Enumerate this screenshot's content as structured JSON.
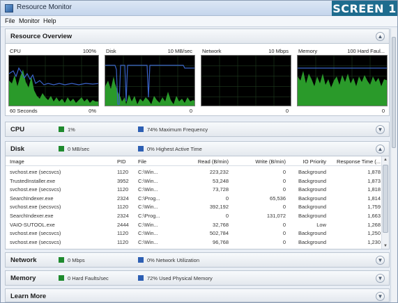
{
  "window": {
    "title": "Resource Monitor",
    "badge": "SCREEN 1"
  },
  "menu": [
    "File",
    "Monitor",
    "Help"
  ],
  "overview": {
    "title": "Resource Overview",
    "graphs": [
      {
        "name": "CPU",
        "max": "100%",
        "foot_left": "60 Seconds",
        "foot_right": "0%"
      },
      {
        "name": "Disk",
        "max": "10 MB/sec",
        "foot_left": "",
        "foot_right": "0"
      },
      {
        "name": "Network",
        "max": "10 Mbps",
        "foot_left": "",
        "foot_right": "0"
      },
      {
        "name": "Memory",
        "max": "100 Hard Faul...",
        "foot_left": "",
        "foot_right": "0"
      }
    ]
  },
  "cpu": {
    "title": "CPU",
    "stat1": "1%",
    "stat2": "74% Maximum Frequency"
  },
  "disk": {
    "title": "Disk",
    "stat1": "0 MB/sec",
    "stat2": "0% Highest Active Time",
    "columns": [
      "Image",
      "PID",
      "File",
      "Read (B/min)",
      "Write (B/min)",
      "IO Priority",
      "Response Time (..."
    ],
    "rows": [
      [
        "svchost.exe (secsvcs)",
        "1120",
        "C:\\Win...",
        "223,232",
        "0",
        "Background",
        "1,878"
      ],
      [
        "TrustedInstaller.exe",
        "3952",
        "C:\\Win...",
        "53,248",
        "0",
        "Background",
        "1,873"
      ],
      [
        "svchost.exe (secsvcs)",
        "1120",
        "C:\\Win...",
        "73,728",
        "0",
        "Background",
        "1,818"
      ],
      [
        "SearchIndexer.exe",
        "2324",
        "C:\\Prog...",
        "0",
        "65,536",
        "Background",
        "1,814"
      ],
      [
        "svchost.exe (secsvcs)",
        "1120",
        "C:\\Win...",
        "392,192",
        "0",
        "Background",
        "1,759"
      ],
      [
        "SearchIndexer.exe",
        "2324",
        "C:\\Prog...",
        "0",
        "131,072",
        "Background",
        "1,663"
      ],
      [
        "VAIO-SUTOOL.exe",
        "2444",
        "C:\\Win...",
        "32,768",
        "0",
        "Low",
        "1,268"
      ],
      [
        "svchost.exe (secsvcs)",
        "1120",
        "C:\\Win...",
        "502,784",
        "0",
        "Background",
        "1,250"
      ],
      [
        "svchost.exe (secsvcs)",
        "1120",
        "C:\\Win...",
        "96,768",
        "0",
        "Background",
        "1,230"
      ]
    ]
  },
  "network": {
    "title": "Network",
    "stat1": "0 Mbps",
    "stat2": "0% Network Utilization"
  },
  "memory": {
    "title": "Memory",
    "stat1": "0 Hard Faults/sec",
    "stat2": "72% Used Physical Memory"
  },
  "learn": {
    "title": "Learn More"
  },
  "colors": {
    "green": "#1f8a2e",
    "blue": "#2d5fb3",
    "graph_fill": "#2a9a2a",
    "graph_line": "#3a63c8",
    "badge": "#1e6c8e"
  },
  "icons": [
    "app-icon",
    "collapse-icon",
    "expand-icon",
    "scroll-up-icon",
    "scroll-down-icon"
  ]
}
